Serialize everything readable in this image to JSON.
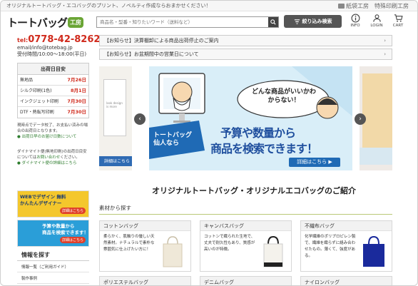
{
  "top": {
    "tagline": "オリジナルトートバッグ・エコバッグのプリント、ノベルティ作成ならおまかせください！",
    "brands": [
      "紙袋工房",
      "特殊印刷工房"
    ]
  },
  "header": {
    "logo": "トートバッグ",
    "logo_badge": "工房",
    "search_placeholder": "商品名・型番・知りたいワード（送料など）",
    "narrow_label": "絞り込み検索",
    "icons": [
      {
        "name": "info",
        "label": "INFO"
      },
      {
        "name": "login",
        "label": "LOGIN"
      },
      {
        "name": "cart",
        "label": "CART"
      }
    ]
  },
  "contact": {
    "tel_prefix": "tel:",
    "tel": "0778-42-8262",
    "email": "email/info@totebag.jp",
    "hours": "受付時間/10:00〜18:00(平日)"
  },
  "notices": [
    "【お知らせ】決算棚卸による商品出荷停止のご案内",
    "【お知らせ】お盆期間中の営業日について"
  ],
  "schedule": {
    "title": "出荷日目安",
    "rows": [
      {
        "label": "無地品",
        "date": "7月26日"
      },
      {
        "label": "シルク印刷(1色)",
        "date": "8月1日"
      },
      {
        "label": "インクジェット印刷",
        "date": "7月30日"
      },
      {
        "label": "DTF・熱転写印刷",
        "date": "7月30日"
      }
    ],
    "note1": "現時点でデータ校了、お支払い済みの場合の出荷日となります。",
    "link1": "出荷日早のお届け日数について",
    "note2": "ダイナマイト便(無地印刷)の出荷日目安については",
    "link2": "お問い合わせ",
    "note2b": "ください。",
    "link3": "ダイナマイト便の詳細はこちら"
  },
  "banners": [
    {
      "text1": "WEBでデザイン 無料",
      "text2": "かんたんデザイナー",
      "pill": "詳細はこちら"
    },
    {
      "text1": "予算や数量から",
      "text2": "商品を検索できます！",
      "pill": "詳細はこちら"
    }
  ],
  "info": {
    "title": "情報を探す",
    "items": [
      "情報一覧（ご利用ガイド）",
      "製作事例"
    ]
  },
  "carousel": {
    "bubble": "どんな商品がいいかわからない！",
    "sennin": "トートバッグ仙人なら",
    "headline1": "予算や数量から",
    "headline2": "商品を検索できます！",
    "button": "詳細はこちら",
    "left_button": "詳細はこちら",
    "left_bag_text": "look design is more"
  },
  "intro_title": "オリジナルトートバッグ・オリジナルエコバッグのご紹介",
  "section_title": "素材から探す",
  "materials": [
    {
      "name": "コットンバッグ",
      "desc": "柔らかく、肌触りの優しい天然素材。ナチュラルで素朴な雰囲気に仕上げたい方に！"
    },
    {
      "name": "キャンバスバッグ",
      "desc": "コットンで織られた生地で、丈夫で耐久性もあり、質感が高いのが特徴。"
    },
    {
      "name": "不織布バッグ",
      "desc": "化学繊維のポリプロピレン製で、繊維を織らずに絡み合わせたもの。薄くて、強度がある。"
    }
  ],
  "materials_row2": [
    "ポリエステルバッグ",
    "デニムバッグ",
    "ナイロンバッグ"
  ],
  "colors": {
    "accent_green": "#6aa535",
    "tel_red": "#d02a1c",
    "nonwoven_blue": "#1a2a9c"
  }
}
